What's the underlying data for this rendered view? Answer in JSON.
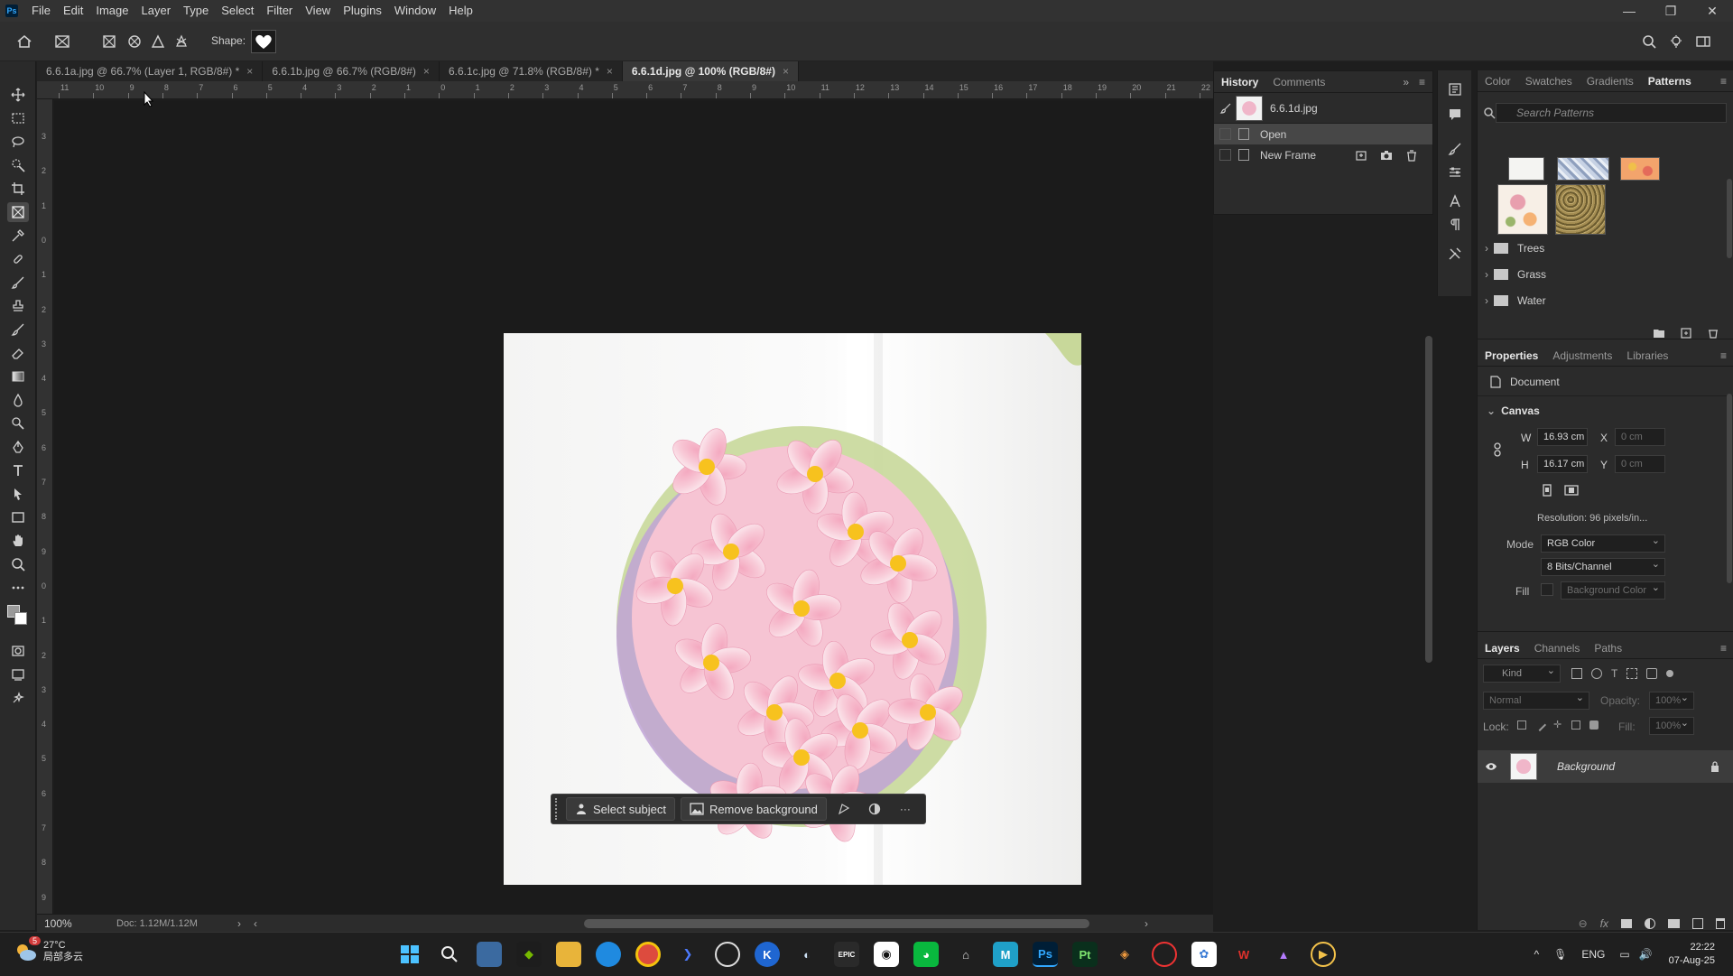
{
  "app": {
    "logo": "Ps"
  },
  "menu": [
    "File",
    "Edit",
    "Image",
    "Layer",
    "Type",
    "Select",
    "Filter",
    "View",
    "Plugins",
    "Window",
    "Help"
  ],
  "window_controls": {
    "minimize": "—",
    "restore": "❐",
    "close": "✕"
  },
  "options_bar": {
    "shape_label": "Shape:"
  },
  "tabs": [
    {
      "label": "6.6.1a.jpg @ 66.7% (Layer 1, RGB/8#) *",
      "close": "×"
    },
    {
      "label": "6.6.1b.jpg @ 66.7% (RGB/8#)",
      "close": "×"
    },
    {
      "label": "6.6.1c.jpg @ 71.8% (RGB/8#) *",
      "close": "×"
    },
    {
      "label": "6.6.1d.jpg @ 100% (RGB/8#)",
      "close": "×"
    }
  ],
  "ruler_h": [
    "11",
    "10",
    "9",
    "8",
    "7",
    "6",
    "5",
    "4",
    "3",
    "2",
    "1",
    "0",
    "1",
    "2",
    "3",
    "4",
    "5",
    "6",
    "7",
    "8",
    "9",
    "10",
    "11",
    "12",
    "13",
    "14",
    "15",
    "16",
    "17",
    "18",
    "19",
    "20",
    "21",
    "22"
  ],
  "ruler_v": [
    "3",
    "2",
    "1",
    "0",
    "1",
    "2",
    "3",
    "4",
    "5",
    "6",
    "7",
    "8",
    "9",
    "0",
    "1",
    "2",
    "3",
    "4",
    "5",
    "6",
    "7",
    "8",
    "9"
  ],
  "context_bar": {
    "select_subject": "Select subject",
    "remove_background": "Remove background",
    "more": "···"
  },
  "status": {
    "zoom": "100%",
    "doc": "Doc: 1.12M/1.12M"
  },
  "history": {
    "tabs": [
      "History",
      "Comments"
    ],
    "snapshot": "6.6.1d.jpg",
    "steps": [
      "Open",
      "New Frame"
    ]
  },
  "patterns": {
    "tabs": [
      "Color",
      "Swatches",
      "Gradients",
      "Patterns"
    ],
    "search_placeholder": "Search Patterns",
    "folders": [
      "Trees",
      "Grass",
      "Water"
    ]
  },
  "properties": {
    "tabs": [
      "Properties",
      "Adjustments",
      "Libraries"
    ],
    "doc_label": "Document",
    "canvas_label": "Canvas",
    "w_label": "W",
    "w_value": "16.93 cm",
    "h_label": "H",
    "h_value": "16.17 cm",
    "x_label": "X",
    "x_value": "0 cm",
    "y_label": "Y",
    "y_value": "0 cm",
    "resolution": "Resolution: 96 pixels/in...",
    "mode_label": "Mode",
    "mode_value": "RGB Color",
    "depth_value": "8 Bits/Channel",
    "fill_label": "Fill",
    "fill_value": "Background Color"
  },
  "layers": {
    "tabs": [
      "Layers",
      "Channels",
      "Paths"
    ],
    "kind": "Kind",
    "blend_mode": "Normal",
    "opacity_label": "Opacity:",
    "opacity_value": "100%",
    "lock_label": "Lock:",
    "fill_label": "Fill:",
    "fill_value": "100%",
    "layer_name": "Background"
  },
  "taskbar": {
    "temp": "27°C",
    "weather": "局部多云",
    "badge": "5",
    "lang": "ENG",
    "time": "22:22",
    "date": "07-Aug-25"
  },
  "colors": {
    "accent": "#31a8ff",
    "panel": "#2b2b2b",
    "workspace": "#1b1b1b"
  }
}
